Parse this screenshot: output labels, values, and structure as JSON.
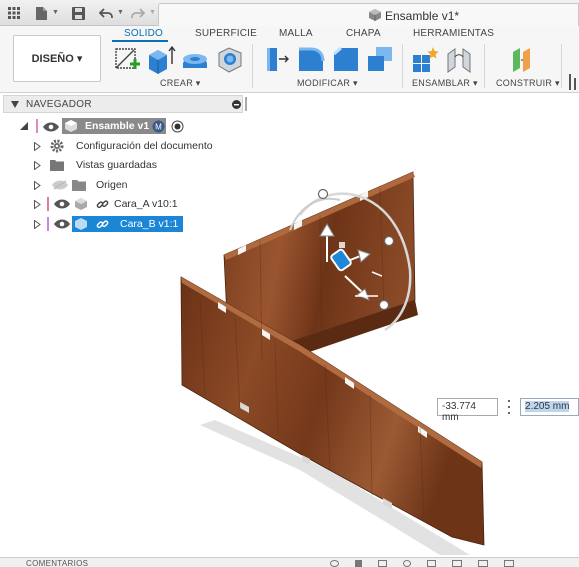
{
  "titlebar": {
    "document_title": "Ensamble v1*",
    "icons": [
      "grid-icon",
      "file-icon",
      "save-icon",
      "undo-icon",
      "redo-icon"
    ]
  },
  "ribbon": {
    "workspace": "DISEÑO ▾",
    "tabs": [
      "SOLIDO",
      "SUPERFICIE",
      "MALLA",
      "CHAPA",
      "HERRAMIENTAS"
    ],
    "active_tab": "SOLIDO",
    "groups": {
      "crear": "CREAR ▾",
      "modificar": "MODIFICAR ▾",
      "ensamblar": "ENSAMBLAR ▾",
      "construir": "CONSTRUIR ▾"
    },
    "accent_color": "#0a6fb5"
  },
  "navigator": {
    "title": "NAVEGADOR",
    "root": "Ensamble v1",
    "items": [
      {
        "label": "Configuración del documento"
      },
      {
        "label": "Vistas guardadas"
      },
      {
        "label": "Origen"
      },
      {
        "label": "Cara_A v10:1"
      },
      {
        "label": "Cara_B v1:1"
      }
    ]
  },
  "viewport": {
    "dimension_1": "-33.774 mm",
    "dimension_2": "2.205 mm"
  },
  "bottom": {
    "comments": "COMENTARIOS"
  }
}
